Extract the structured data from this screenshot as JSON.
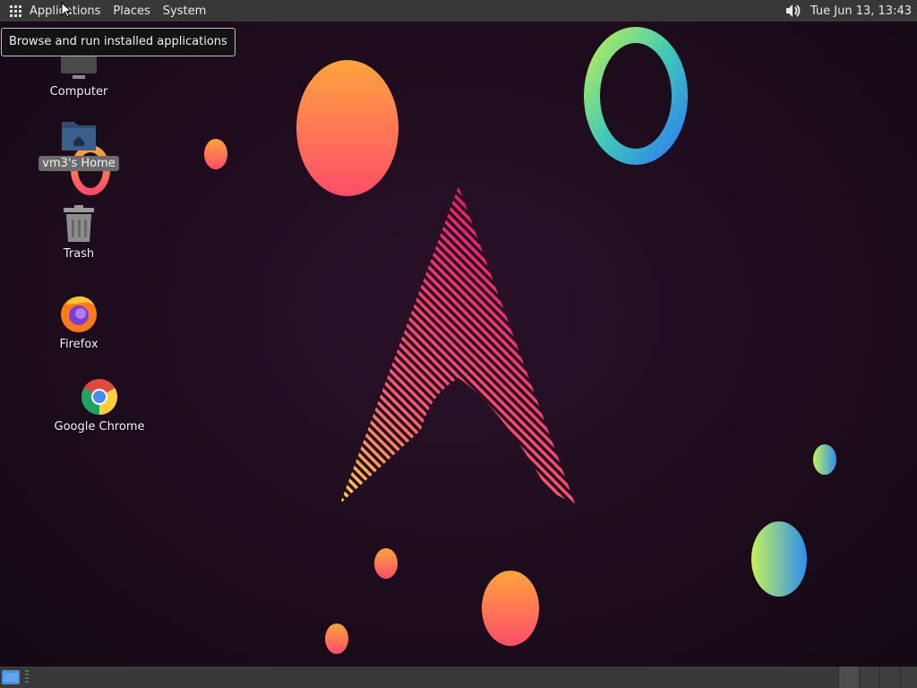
{
  "top_panel": {
    "menus": {
      "applications": "Applications",
      "places": "Places",
      "system": "System"
    },
    "clock": "Tue Jun 13, 13:43",
    "icons": {
      "apps": "apps-grid-icon",
      "volume": "volume-icon"
    }
  },
  "tooltip": {
    "text": "Browse and run installed applications"
  },
  "desktop_icons": {
    "computer": {
      "label": "Computer",
      "icon": "computer-icon"
    },
    "home": {
      "label": "vm3's Home",
      "icon": "home-folder-icon"
    },
    "trash": {
      "label": "Trash",
      "icon": "trash-icon"
    },
    "firefox": {
      "label": "Firefox",
      "icon": "firefox-icon"
    },
    "chrome": {
      "label": "Google Chrome",
      "icon": "chrome-icon"
    }
  },
  "bottom_panel": {
    "show_desktop": "show-desktop-icon",
    "workspaces": 4
  },
  "colors": {
    "panel": "#383838",
    "wallpaper": "#1d0c1d",
    "accent": "#4a8fd8"
  }
}
